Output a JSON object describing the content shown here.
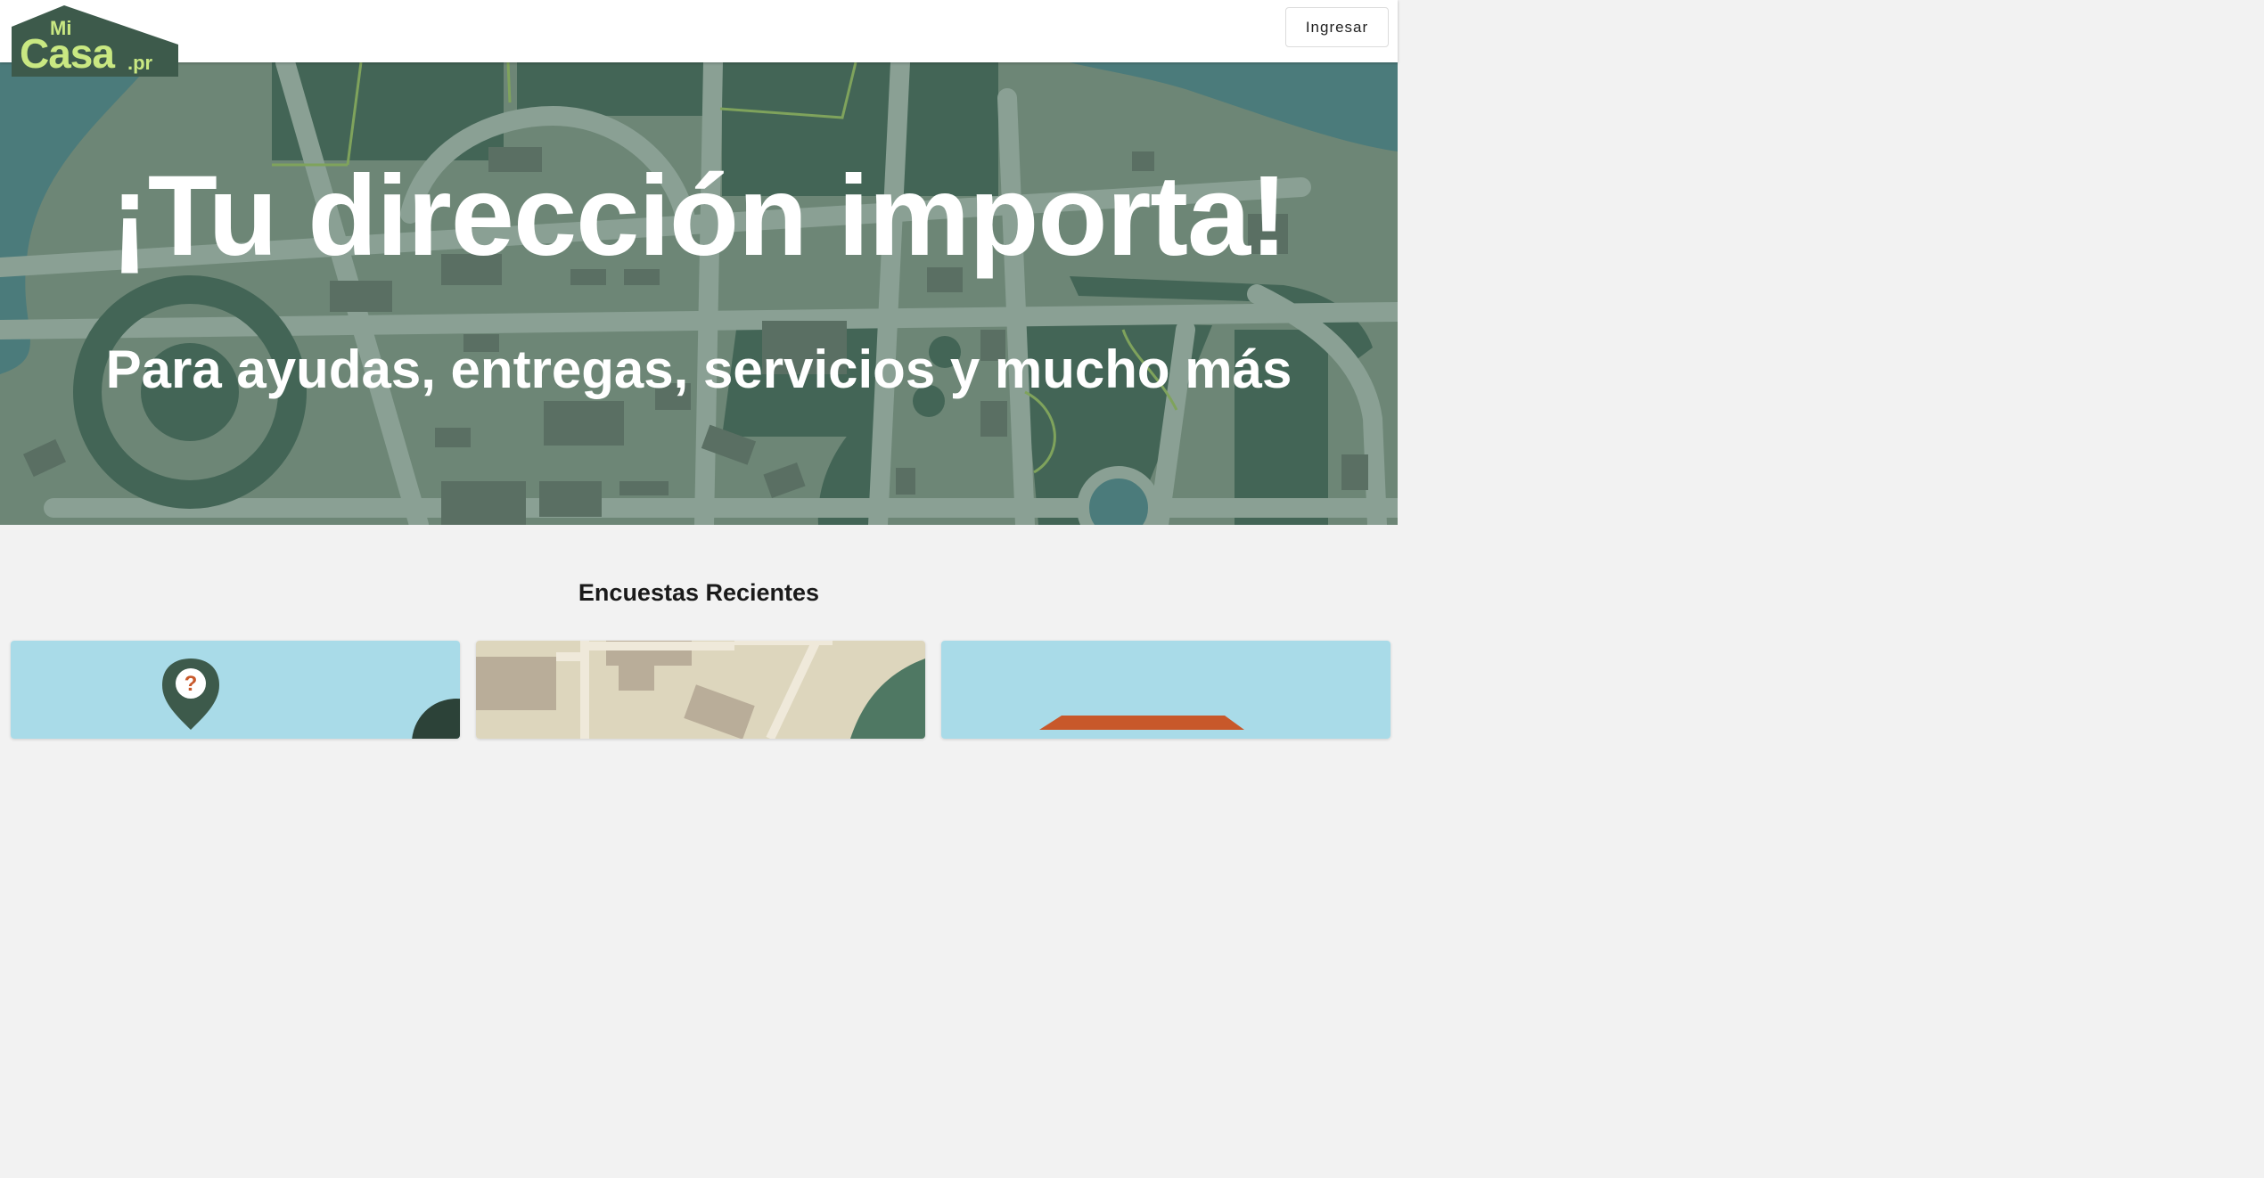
{
  "header": {
    "logo": {
      "mi": "Mi",
      "casa": "Casa",
      "pr": ".pr"
    },
    "login_label": "Ingresar"
  },
  "hero": {
    "title": "¡Tu dirección importa!",
    "subtitle": "Para ayudas, entregas, servicios y mucho más"
  },
  "surveys": {
    "section_title": "Encuestas Recientes",
    "cards": [
      {
        "icon": "question-pin-icon"
      },
      {
        "icon": "map-illustration"
      },
      {
        "icon": "house-illustration"
      }
    ]
  },
  "colors": {
    "map_base": "#6d8676",
    "map_dark": "#436556",
    "map_water": "#4b7b7b",
    "logo_green": "#3d5a4b",
    "logo_lime": "#c9e882"
  }
}
